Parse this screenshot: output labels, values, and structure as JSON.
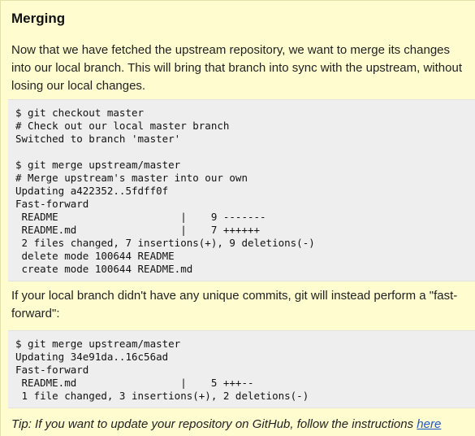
{
  "heading": "Merging",
  "intro": "Now that we have fetched the upstream repository, we want to merge its changes into our local branch. This will bring that branch into sync with the upstream, without losing our local changes.",
  "code_block_1": [
    "$ git checkout master",
    "# Check out our local master branch",
    "Switched to branch 'master'",
    "",
    "$ git merge upstream/master",
    "# Merge upstream's master into our own",
    "Updating a422352..5fdff0f",
    "Fast-forward",
    " README                    |    9 -------",
    " README.md                 |    7 ++++++",
    " 2 files changed, 7 insertions(+), 9 deletions(-)",
    " delete mode 100644 README",
    " create mode 100644 README.md"
  ],
  "fast_forward_note": "If your local branch didn't have any unique commits, git will instead perform a \"fast-forward\":",
  "code_block_2": [
    "$ git merge upstream/master",
    "Updating 34e91da..16c56ad",
    "Fast-forward",
    " README.md                 |    5 +++--",
    " 1 file changed, 3 insertions(+), 2 deletions(-)"
  ],
  "tip": {
    "text": "Tip: If you want to update your repository on GitHub, follow the instructions ",
    "link_label": "here"
  },
  "colors": {
    "background": "#fffdcf",
    "code_background": "#eeeeee",
    "link": "#2255cc"
  }
}
